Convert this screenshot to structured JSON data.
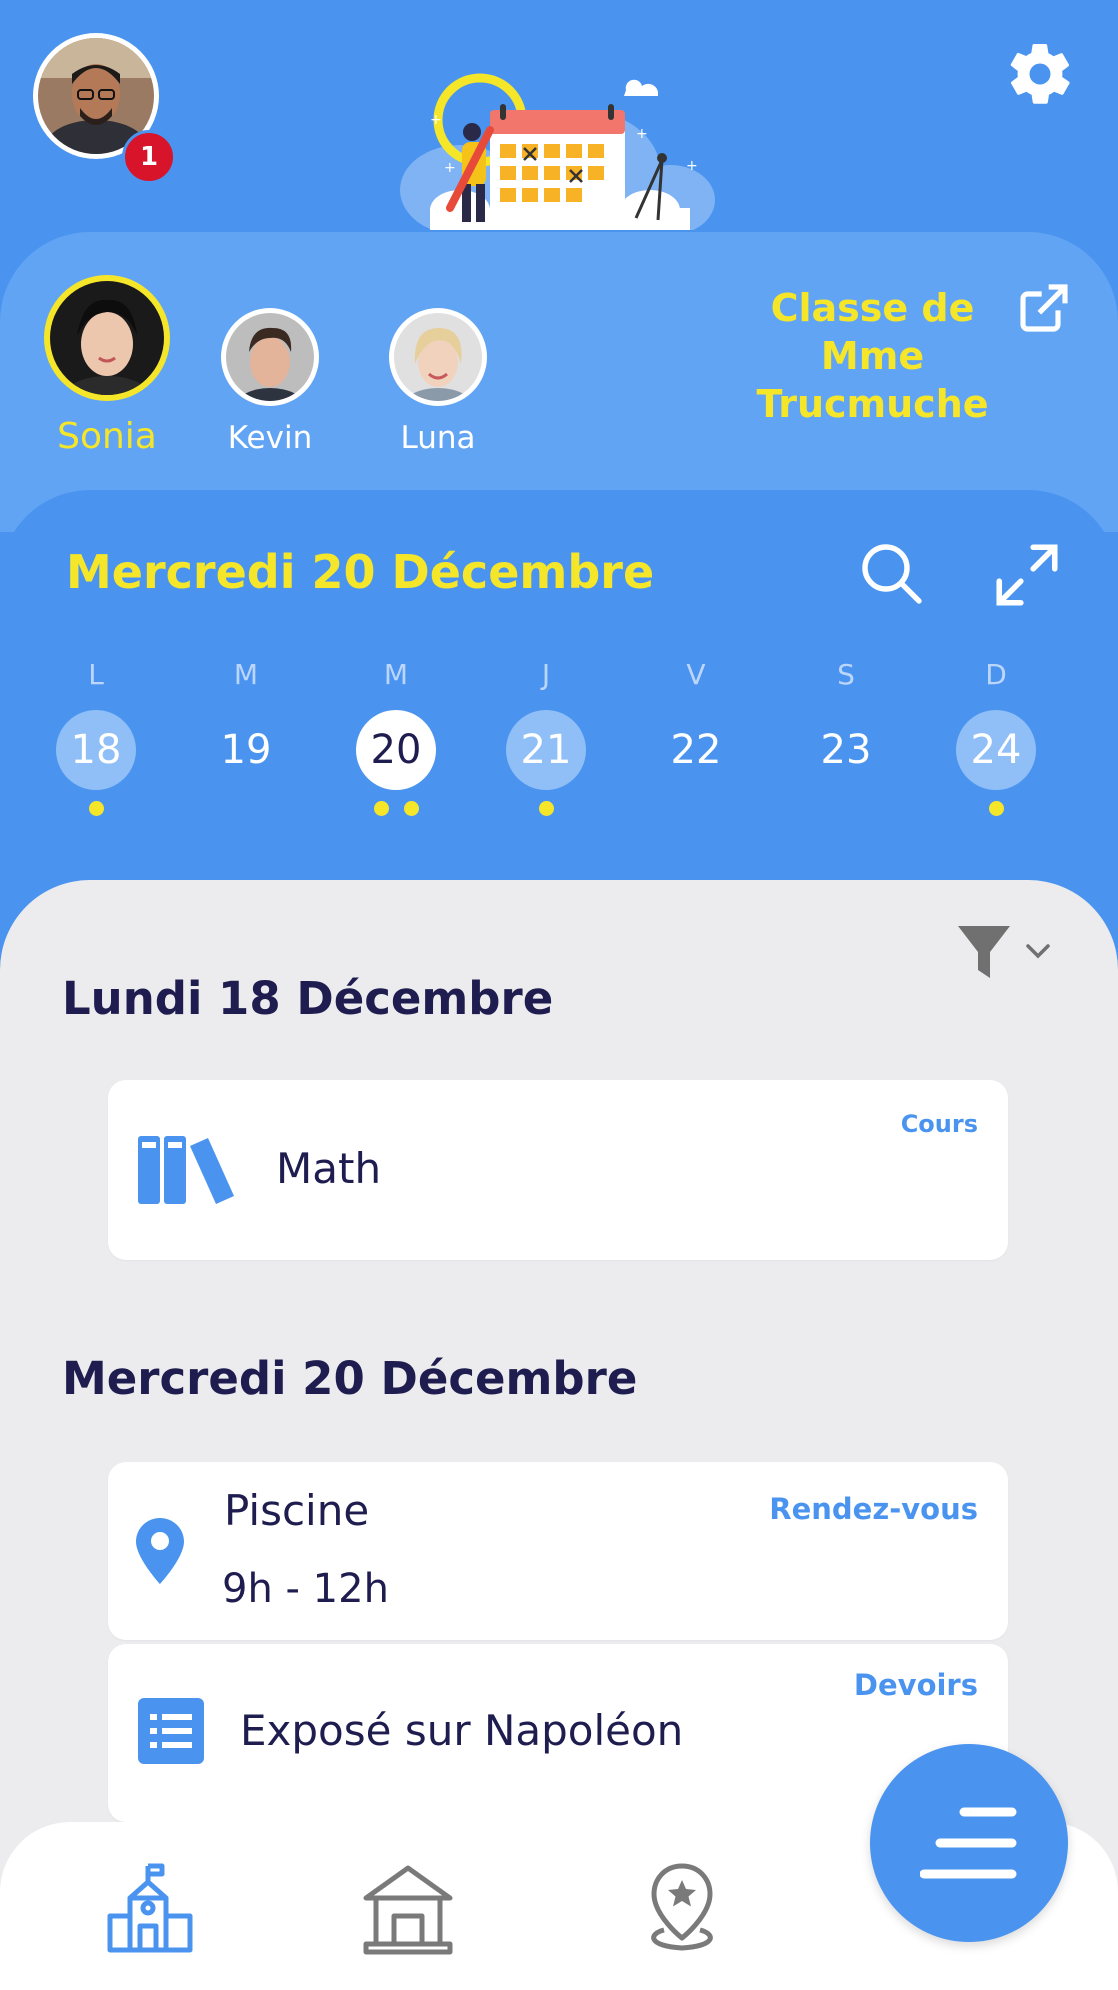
{
  "header": {
    "notification_count": "1",
    "icons": {
      "settings": "gear-icon",
      "illustration": "calendar-illustration"
    }
  },
  "kids": [
    {
      "name": "Sonia",
      "active": true
    },
    {
      "name": "Kevin",
      "active": false
    },
    {
      "name": "Luna",
      "active": false
    }
  ],
  "class_label": [
    "Classe de",
    "Mme",
    "Trucmuche"
  ],
  "calendar": {
    "selected_date_label": "Mercredi 20 Décembre",
    "week": [
      {
        "dow": "L",
        "day": "18",
        "events": 1,
        "highlight": true
      },
      {
        "dow": "M",
        "day": "19",
        "events": 0,
        "highlight": false
      },
      {
        "dow": "M",
        "day": "20",
        "events": 2,
        "selected": true
      },
      {
        "dow": "J",
        "day": "21",
        "events": 1,
        "highlight": true
      },
      {
        "dow": "V",
        "day": "22",
        "events": 0,
        "highlight": false
      },
      {
        "dow": "S",
        "day": "23",
        "events": 0,
        "highlight": false
      },
      {
        "dow": "D",
        "day": "24",
        "events": 1,
        "highlight": true
      }
    ]
  },
  "agenda": {
    "sections": [
      {
        "heading": "Lundi 18 Décembre",
        "items": [
          {
            "type_label": "Cours",
            "title": "Math",
            "icon": "books-icon"
          }
        ]
      },
      {
        "heading": "Mercredi 20 Décembre",
        "items": [
          {
            "type_label": "Rendez-vous",
            "title": "Piscine",
            "time": "9h - 12h",
            "icon": "location-pin-icon"
          },
          {
            "type_label": "Devoirs",
            "title": "Exposé sur Napoléon",
            "icon": "list-icon"
          }
        ]
      }
    ]
  },
  "colors": {
    "primary": "#4a94f0",
    "accent": "#f5e62a",
    "text_dark": "#1f1d4f",
    "badge": "#d7142a"
  }
}
